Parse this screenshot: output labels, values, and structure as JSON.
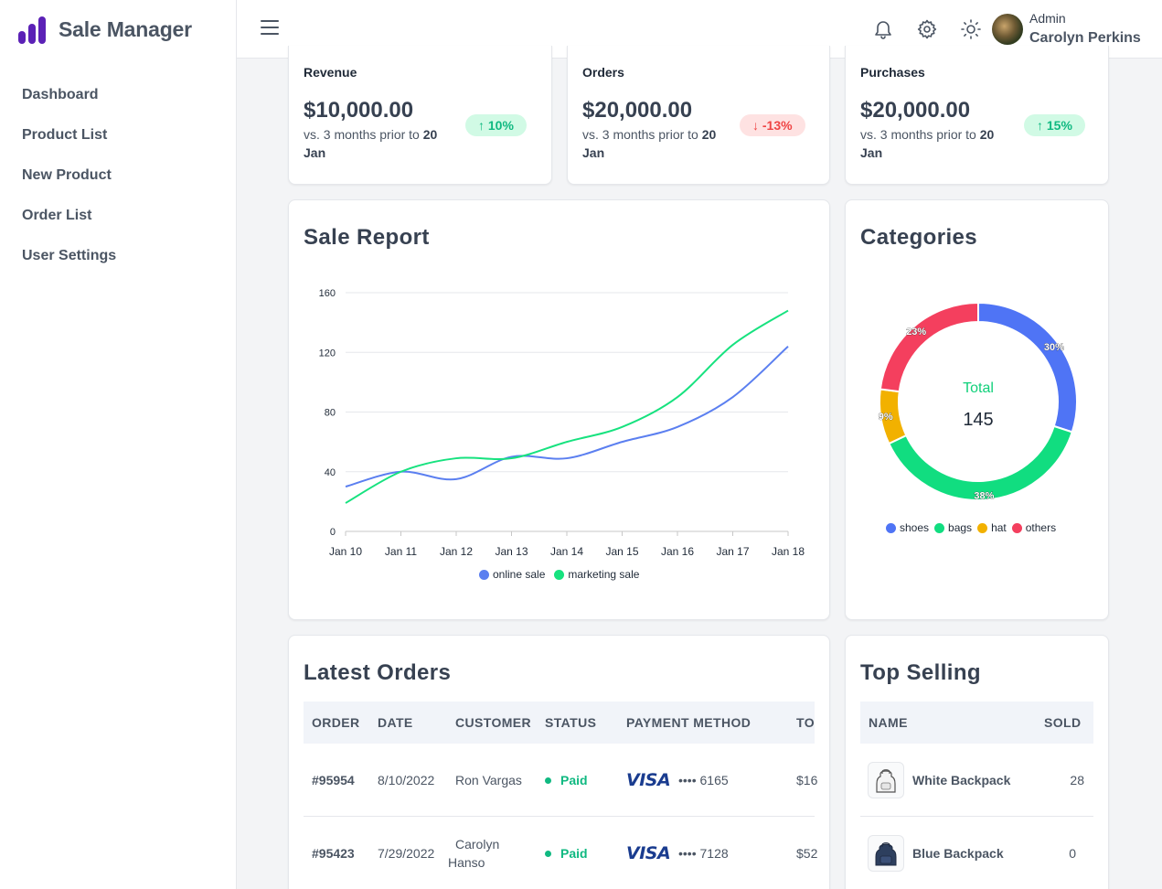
{
  "app": {
    "title": "Sale Manager"
  },
  "sidebar": {
    "items": [
      {
        "label": "Dashboard"
      },
      {
        "label": "Product List"
      },
      {
        "label": "New Product"
      },
      {
        "label": "Order List"
      },
      {
        "label": "User Settings"
      }
    ]
  },
  "header": {
    "user_role": "Admin",
    "user_name": "Carolyn Perkins",
    "icons": [
      "menu-icon",
      "bell-icon",
      "gear-icon",
      "sun-icon"
    ]
  },
  "stats": [
    {
      "label": "Revenue",
      "value": "$10,000.00",
      "compare_prefix": "vs. 3 months prior to ",
      "compare_date_bold": "20",
      "compare_date_rest": "Jan",
      "change": "10%",
      "trend": "up"
    },
    {
      "label": "Orders",
      "value": "$20,000.00",
      "compare_prefix": "vs. 3 months prior to ",
      "compare_date_bold": "20",
      "compare_date_rest": "Jan",
      "change": "-13%",
      "trend": "down"
    },
    {
      "label": "Purchases",
      "value": "$20,000.00",
      "compare_prefix": "vs. 3 months prior to ",
      "compare_date_bold": "20",
      "compare_date_rest": "Jan",
      "change": "15%",
      "trend": "up"
    }
  ],
  "colors": {
    "online": "#5b7ff0",
    "marketing": "#17e27f",
    "shoes": "#4f74f5",
    "bags": "#11dd80",
    "hat": "#f2b100",
    "others": "#f43f5e",
    "paid": "#10b981",
    "brand": "#5b21b6"
  },
  "chart_data": [
    {
      "type": "line",
      "title": "Sale Report",
      "categories": [
        "Jan 10",
        "Jan 11",
        "Jan 12",
        "Jan 13",
        "Jan 14",
        "Jan 15",
        "Jan 16",
        "Jan 17",
        "Jan 18"
      ],
      "series": [
        {
          "name": "online sale",
          "values": [
            30,
            40,
            35,
            50,
            49,
            60,
            70,
            90,
            124
          ]
        },
        {
          "name": "marketing sale",
          "values": [
            19,
            40,
            49,
            49,
            60,
            70,
            90,
            125,
            148
          ]
        }
      ],
      "ylim": [
        0,
        160
      ],
      "yticks": [
        "0",
        "40",
        "80",
        "120",
        "160"
      ],
      "grid": true,
      "legend": "bottom"
    },
    {
      "type": "pie",
      "title": "Categories",
      "center_label": "Total",
      "center_value": "145",
      "categories": [
        "shoes",
        "bags",
        "hat",
        "others"
      ],
      "values": [
        30,
        38,
        9,
        23
      ],
      "data_labels": [
        "30%",
        "38%",
        "9%",
        "23%"
      ],
      "legend": "bottom"
    }
  ],
  "latest_orders": {
    "title": "Latest Orders",
    "columns": [
      "ORDER",
      "DATE",
      "CUSTOMER",
      "STATUS",
      "PAYMENT METHOD",
      "TO"
    ],
    "rows": [
      {
        "order": "#95954",
        "date": "8/10/2022",
        "customer": "Ron Vargas",
        "customer_line2": "",
        "status": "Paid",
        "card_brand": "VISA",
        "card_last4": "•••• 6165",
        "total": "$16"
      },
      {
        "order": "#95423",
        "date": "7/29/2022",
        "customer": "Carolyn",
        "customer_line2": "Hanso",
        "status": "Paid",
        "card_brand": "VISA",
        "card_last4": "•••• 7128",
        "total": "$52"
      }
    ]
  },
  "top_selling": {
    "title": "Top Selling",
    "columns": [
      "NAME",
      "SOLD"
    ],
    "rows": [
      {
        "name": "White Backpack",
        "sold": "28",
        "color": "white"
      },
      {
        "name": "Blue Backpack",
        "sold": "0",
        "color": "blue"
      }
    ]
  }
}
